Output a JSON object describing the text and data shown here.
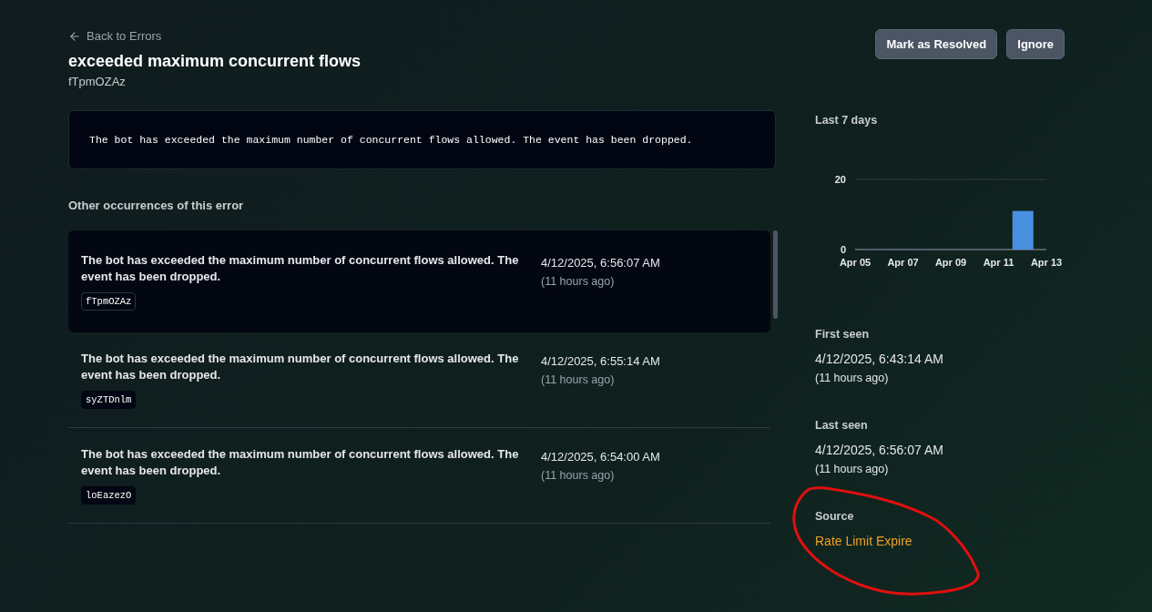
{
  "header": {
    "back_link": "Back to Errors",
    "title": "exceeded maximum concurrent flows",
    "error_id": "fTpmOZAz",
    "actions": [
      "Mark as Resolved",
      "Ignore"
    ]
  },
  "message": "The bot has exceeded the maximum number of concurrent flows allowed. The event has been dropped.",
  "occurrences": {
    "heading": "Other occurrences of this error",
    "items": [
      {
        "message": "The bot has exceeded the maximum number of concurrent flows allowed. The event has been dropped.",
        "id": "fTpmOZAz",
        "timestamp": "4/12/2025, 6:56:07 AM",
        "relative": "(11 hours ago)",
        "selected": true
      },
      {
        "message": "The bot has exceeded the maximum number of concurrent flows allowed. The event has been dropped.",
        "id": "syZTDnlm",
        "timestamp": "4/12/2025, 6:55:14 AM",
        "relative": "(11 hours ago)",
        "selected": false
      },
      {
        "message": "The bot has exceeded the maximum number of concurrent flows allowed. The event has been dropped.",
        "id": "loEazezO",
        "timestamp": "4/12/2025, 6:54:00 AM",
        "relative": "(11 hours ago)",
        "selected": false
      }
    ]
  },
  "sidebar": {
    "chart_title": "Last 7 days",
    "chart_data": {
      "type": "bar",
      "categories": [
        "Apr 05",
        null,
        "Apr 07",
        null,
        "Apr 09",
        null,
        "Apr 11",
        null,
        "Apr 13"
      ],
      "series": [
        {
          "color": "#4a90e2",
          "values": [
            0,
            0,
            0,
            0,
            0,
            0,
            0,
            11,
            0
          ]
        }
      ],
      "ylim": [
        0,
        20
      ],
      "yticks": [
        0,
        20
      ]
    },
    "stats": [
      {
        "label": "First seen",
        "value": "4/12/2025, 6:43:14 AM",
        "relative": "(11 hours ago)"
      },
      {
        "label": "Last seen",
        "value": "4/12/2025, 6:56:07 AM",
        "relative": "(11 hours ago)"
      }
    ],
    "source": {
      "label": "Source",
      "value": "Rate Limit Expire"
    }
  }
}
